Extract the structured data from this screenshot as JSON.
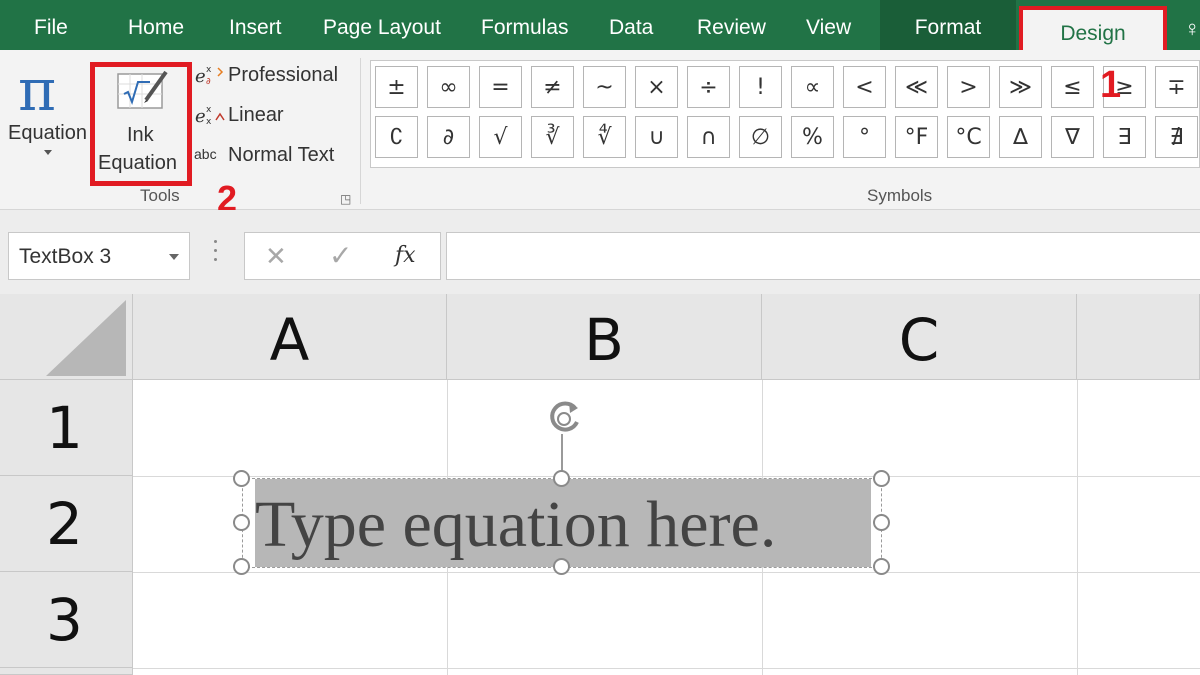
{
  "tabs": {
    "file": "File",
    "home": "Home",
    "insert": "Insert",
    "page_layout": "Page Layout",
    "formulas": "Formulas",
    "data": "Data",
    "review": "Review",
    "view": "View",
    "format": "Format",
    "design": "Design"
  },
  "ribbon": {
    "equation_label": "Equation",
    "ink_equation_line1": "Ink",
    "ink_equation_line2": "Equation",
    "tools_options": [
      "Professional",
      "Linear",
      "Normal Text"
    ],
    "tools_group_label": "Tools",
    "symbols_group_label": "Symbols",
    "symbols_row1": [
      "±",
      "∞",
      "=",
      "≠",
      "~",
      "×",
      "÷",
      "!",
      "∝",
      "<",
      "≪",
      ">",
      "≫",
      "≤",
      "≥",
      "∓"
    ],
    "symbols_row2": [
      "∁",
      "∂",
      "√",
      "∛",
      "∜",
      "∪",
      "∩",
      "∅",
      "%",
      "°",
      "°F",
      "°C",
      "∆",
      "∇",
      "∃",
      "∄"
    ]
  },
  "annotations": {
    "marker1": "1",
    "marker2": "2"
  },
  "formula_bar": {
    "name_box": "TextBox 3",
    "fx": "fx",
    "formula": ""
  },
  "grid": {
    "columns": [
      "A",
      "B",
      "C"
    ],
    "rows": [
      "1",
      "2",
      "3"
    ]
  },
  "equation_box": {
    "text": "Type equation here."
  },
  "colors": {
    "ribbon_green": "#217346",
    "highlight_red": "#e11b22",
    "pi_blue": "#2f6cb5"
  },
  "icons": [
    "pi-icon",
    "ink-equation-icon",
    "professional-icon",
    "linear-icon",
    "normal-text-icon",
    "cancel-icon",
    "enter-icon",
    "fx-icon",
    "rotate-handle-icon"
  ]
}
